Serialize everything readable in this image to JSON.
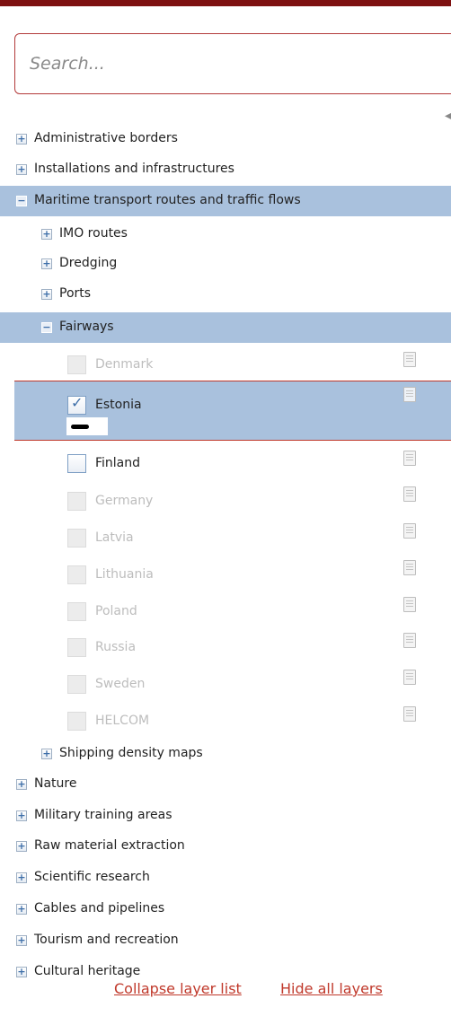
{
  "search": {
    "placeholder": "Search..."
  },
  "tree": {
    "administrative_borders": "Administrative borders",
    "installations": "Installations and infrastructures",
    "maritime": "Maritime transport routes and traffic flows",
    "imo_routes": "IMO routes",
    "dredging": "Dredging",
    "ports": "Ports",
    "fairways": "Fairways",
    "shipping_density": "Shipping density maps",
    "nature": "Nature",
    "military": "Military training areas",
    "raw_material": "Raw material extraction",
    "scientific": "Scientific research",
    "cables": "Cables and pipelines",
    "tourism": "Tourism and recreation",
    "cultural": "Cultural heritage"
  },
  "toggles": {
    "expand": "+",
    "collapse": "−"
  },
  "fairway_layers": {
    "denmark": "Denmark",
    "estonia": "Estonia",
    "finland": "Finland",
    "germany": "Germany",
    "latvia": "Latvia",
    "lithuania": "Lithuania",
    "poland": "Poland",
    "russia": "Russia",
    "sweden": "Sweden",
    "helcom": "HELCOM"
  },
  "checked": {
    "tick": "✓"
  },
  "footer": {
    "collapse": "Collapse layer list",
    "hide": "Hide all layers"
  },
  "colors": {
    "accent": "#c0392b",
    "topbar": "#7e1111",
    "selection": "#a9c1dd"
  }
}
